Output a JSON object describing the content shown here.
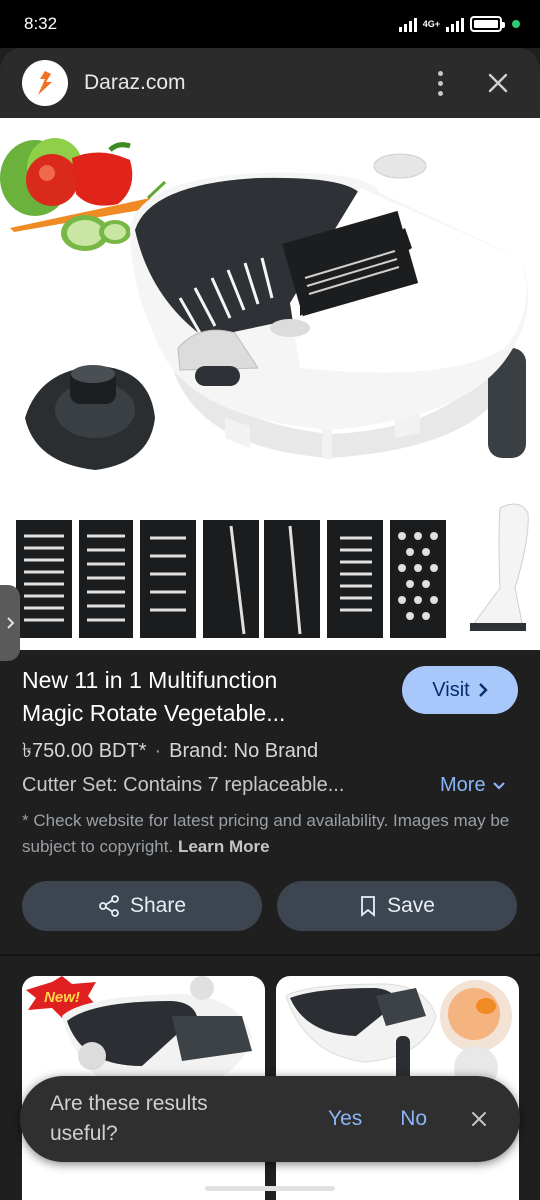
{
  "status": {
    "time": "8:32",
    "network": "4G+"
  },
  "browser": {
    "site_name": "Daraz.com"
  },
  "product": {
    "title_line1": "New 11 in 1 Multifunction",
    "title_line2": "Magic Rotate Vegetable...",
    "visit_label": "Visit",
    "price": "৳750.00 BDT*",
    "separator": "·",
    "brand": "Brand: No Brand",
    "description": "Cutter Set: Contains 7 replaceable...",
    "more_label": "More",
    "disclaimer": "* Check website for latest pricing and availability. Images may be subject to copyright.",
    "learn_more": "Learn More"
  },
  "actions": {
    "share_label": "Share",
    "save_label": "Save"
  },
  "related": {
    "badge": "New!"
  },
  "feedback": {
    "question": "Are these results useful?",
    "yes": "Yes",
    "no": "No"
  },
  "colors": {
    "accent": "#a8c7fa",
    "link": "#8ab4f8",
    "background": "#1f1f1f",
    "brand_orange": "#f36f21"
  }
}
